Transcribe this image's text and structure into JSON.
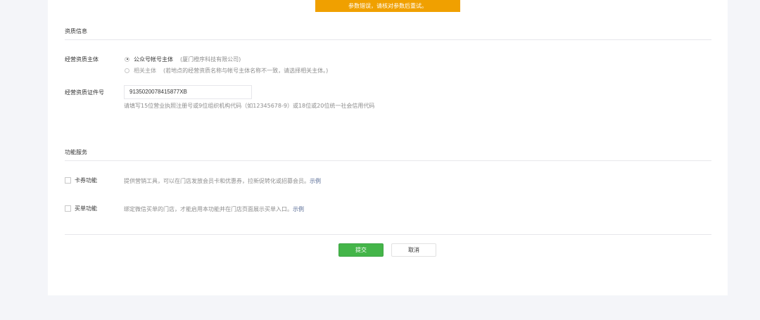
{
  "toast": {
    "message": "参数错误，请核对参数后重试。"
  },
  "qualification": {
    "section_title": "资质信息",
    "entity_label": "经营资质主体",
    "options": [
      {
        "label": "公众号帐号主体",
        "note": "(厦门橙序科技有限公司)",
        "selected": true
      },
      {
        "label": "相关主体",
        "note": "(若地点的经营资质名称与帐号主体名称不一致，请选择相关主体。)",
        "selected": false
      }
    ],
    "cert_label": "经营资质证件号",
    "cert_value": "9135020078415877XB",
    "cert_hint": "请填写15位营业执照注册号或9位组织机构代码（如12345678-9）或18位或20位统一社会信用代码"
  },
  "services": {
    "section_title": "功能服务",
    "items": [
      {
        "label": "卡券功能",
        "desc": "提供营销工具，可以在门店发放会员卡和优惠券，拉新促转化或招募会员。",
        "link": "示例",
        "checked": false
      },
      {
        "label": "买单功能",
        "desc": "绑定微信买单的门店，才能启用本功能并在门店页面展示买单入口。",
        "link": "示例",
        "checked": false
      }
    ]
  },
  "actions": {
    "submit": "提交",
    "cancel": "取消"
  },
  "colors": {
    "toast_bg": "#f0a000",
    "primary": "#44b549",
    "link": "#576b95"
  }
}
